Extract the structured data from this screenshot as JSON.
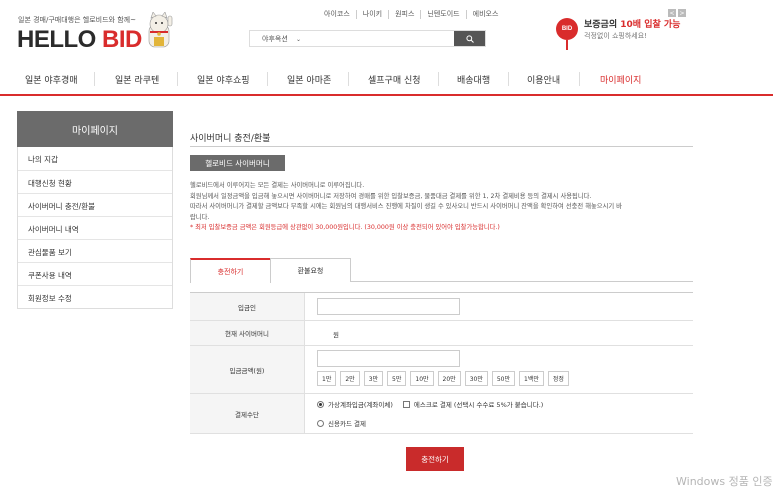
{
  "header": {
    "tagline": "일본 경매/구매대행은 헬로비드와 함께~",
    "logo_part1": "HELLO",
    "logo_part2": "BID",
    "top_links": [
      "아이코스",
      "나이키",
      "원피스",
      "닌텐도이드",
      "에비오스"
    ],
    "search": {
      "select_value": "야후옥션"
    },
    "promo": {
      "badge": "BID",
      "prefix": "보증금의 ",
      "highlight": "10배 입찰 가능",
      "sub": "걱정없이 쇼핑하세요!"
    },
    "pager": [
      "<",
      ">"
    ]
  },
  "nav": {
    "items": [
      "일본 야후경매",
      "일본 라쿠텐",
      "일본 야후쇼핑",
      "일본 아마존",
      "셀프구매 신청",
      "배송대행",
      "이용안내",
      "마이페이지"
    ]
  },
  "sidebar": {
    "title": "마이페이지",
    "items": [
      "나의 지갑",
      "대행신청 현황",
      "사이버머니 충전/환불",
      "사이버머니 내역",
      "관심물품 보기",
      "쿠폰사용 내역",
      "회원정보 수정"
    ]
  },
  "main": {
    "title": "사이버머니 충전/환불",
    "section_button": "헬로비드 사이버머니",
    "desc_lines": [
      "헬로비드에서 이루어지는 모든 결제는 사이버머니로 이루어집니다.",
      "회원님께서 일정금액을 입금해 놓으시면 사이버머니로 저장하여 경매를 위한 입찰보증금, 물품대금 결제를 위한 1, 2차 결제비용 등의 결제시 사용됩니다.",
      "따라서 사이버머니가 결제할 금액보다 부족할 시에는 회원님의 대행서비스 진행에 차질이 생길 수 있사오니 반드시 사이버머니 잔액을 확인하여 선충전 해놓으시기 바",
      "랍니다."
    ],
    "notice": "* 최저 입찰보증금 금액은 회원등급에 상관없이 30,000원입니다. (30,000원 이상 충전되어 있어야 입찰가능합니다.)",
    "tabs": [
      "충전하기",
      "환불요청"
    ],
    "form": {
      "depositor_label": "입금인",
      "current_label": "현재 사이버머니",
      "current_unit": "원",
      "amount_label": "입금금액(원)",
      "amount_buttons": [
        "1만",
        "2만",
        "3만",
        "5만",
        "10만",
        "20만",
        "30만",
        "50만",
        "1백만",
        "정정"
      ],
      "payment_label": "결제수단",
      "option_virtual": "가상계좌입금(계좌이체)",
      "option_escrow": "에스크로 결제 (선택시 수수료 5%가 붙습니다.)",
      "option_card": "신용카드 결제"
    },
    "submit_label": "충전하기"
  },
  "watermark": "Windows 정품 인증"
}
